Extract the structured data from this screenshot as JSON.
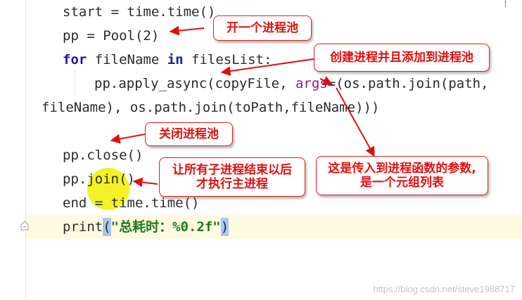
{
  "code": {
    "line1": "start = time.time()",
    "line2": "pp = Pool(2)",
    "line3_kw1": "for",
    "line3_mid": " fileName ",
    "line3_kw2": "in",
    "line3_end": " filesList:",
    "line4_pre": "pp.apply_async(copyFile, ",
    "line4_arg": "args",
    "line4_post": "=(os.path.join(path,",
    "line5": "fileName), os.path.join(toPath,fileName)))",
    "line6": "pp.close()",
    "line7": "pp.join()",
    "line8": "end = time.time()",
    "line9_func": "print",
    "line9_open": "(",
    "line9_str": "\"总耗时：%0.2f\"",
    "line9_close": ")"
  },
  "annotations": {
    "create_pool": "开一个进程池",
    "create_and_add": "创建进程并且添加到进程池",
    "close_pool": "关闭进程池",
    "wait_line1": "让所有子进程结束以后",
    "wait_line2": "才执行主进程",
    "args_line1": "这是传入到进程函数的参数,",
    "args_line2": "是一个元组列表"
  },
  "watermark": "https://blog.csdn.net/steve1988717",
  "colors": {
    "annotation_red": "#e01010",
    "keyword_blue": "#1a1aa6",
    "string_green": "#1c7a1c",
    "brace_highlight": "#a9c6f5",
    "current_line": "#fffbe0",
    "cursor_halo": "#f0f000"
  }
}
